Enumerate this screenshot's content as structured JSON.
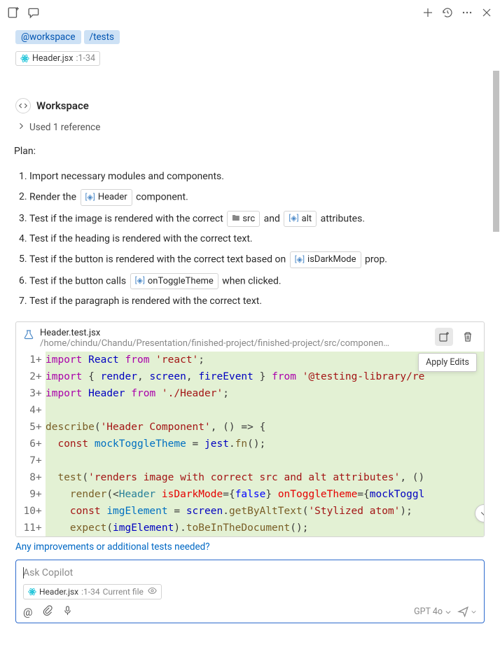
{
  "toolbar": {
    "new_chat_icon": "new-chat",
    "chat_icon": "chat-bubble"
  },
  "badges": {
    "workspace": "@workspace",
    "tests": "/tests"
  },
  "file_ref": {
    "name": "Header.jsx",
    "range": ":1-34"
  },
  "section": {
    "title": "Workspace",
    "references": "Used 1 reference"
  },
  "plan_label": "Plan:",
  "plan": [
    {
      "pre": "Import necessary modules and components.",
      "chips": []
    },
    {
      "pre": "Render the ",
      "chips": [
        {
          "icon": "sym",
          "text": "Header"
        }
      ],
      "post": " component."
    },
    {
      "pre": "Test if the image is rendered with the correct ",
      "chips": [
        {
          "icon": "folder",
          "text": "src"
        }
      ],
      "mid": " and ",
      "chips2": [
        {
          "icon": "sym",
          "text": "alt"
        }
      ],
      "post": " attributes."
    },
    {
      "pre": "Test if the heading is rendered with the correct text.",
      "chips": []
    },
    {
      "pre": "Test if the button is rendered with the correct text based on ",
      "chips": [
        {
          "icon": "sym",
          "text": "isDarkMode"
        }
      ],
      "post": " prop."
    },
    {
      "pre": "Test if the button calls ",
      "chips": [
        {
          "icon": "sym",
          "text": "onToggleTheme"
        }
      ],
      "post": " when clicked."
    },
    {
      "pre": "Test if the paragraph is rendered with the correct text.",
      "chips": []
    }
  ],
  "code_panel": {
    "filename": "Header.test.jsx",
    "filepath": "/home/chindu/Chandu/Presentation/finished-project/finished-project/src/componen…",
    "tooltip": "Apply Edits"
  },
  "code_lines": [
    {
      "n": "1",
      "plus": "+",
      "html": "<span class='tok-import'>import</span> <span class='tok-id'>React</span> <span class='tok-from'>from</span> <span class='tok-str'>'react'</span>;"
    },
    {
      "n": "2",
      "plus": "+",
      "html": "<span class='tok-import'>import</span> { <span class='tok-id'>render</span>, <span class='tok-id'>screen</span>, <span class='tok-id'>fireEvent</span> } <span class='tok-from'>from</span> <span class='tok-str'>'@testing-library/re</span>"
    },
    {
      "n": "3",
      "plus": "+",
      "html": "<span class='tok-import'>import</span> <span class='tok-id'>Header</span> <span class='tok-from'>from</span> <span class='tok-str'>'./Header'</span>;"
    },
    {
      "n": "4",
      "plus": "+",
      "html": ""
    },
    {
      "n": "5",
      "plus": "+",
      "html": "<span class='tok-fn'>describe</span>(<span class='tok-str'>'Header Component'</span>, () <span class='tok-op'>=&gt;</span> {"
    },
    {
      "n": "6",
      "plus": "+",
      "html": "  <span class='tok-kw'>const</span> <span class='tok-param'>mockToggleTheme</span> = <span class='tok-id'>jest</span>.<span class='tok-fn'>fn</span>();"
    },
    {
      "n": "7",
      "plus": "+",
      "html": ""
    },
    {
      "n": "8",
      "plus": "+",
      "html": "  <span class='tok-fn'>test</span>(<span class='tok-str'>'renders image with correct src and alt attributes'</span>, ()"
    },
    {
      "n": "9",
      "plus": "+",
      "html": "    <span class='tok-fn'>render</span>(&lt;<span class='tok-comp'>Header</span> <span class='tok-attr'>isDarkMode</span>={<span class='tok-bool'>false</span>} <span class='tok-attr'>onToggleTheme</span>={<span class='tok-id'>mockToggl</span>"
    },
    {
      "n": "10",
      "plus": "+",
      "html": "    <span class='tok-kw'>const</span> <span class='tok-param'>imgElement</span> = <span class='tok-id'>screen</span>.<span class='tok-fn'>getByAltText</span>(<span class='tok-str'>'Stylized atom'</span>);"
    },
    {
      "n": "11",
      "plus": "+",
      "html": "    <span class='tok-fn'>expect</span>(<span class='tok-id'>imgElement</span>).<span class='tok-fn'>toBeInTheDocument</span>();"
    }
  ],
  "followup": "Any improvements or additional tests needed?",
  "input": {
    "placeholder": "Ask Copilot",
    "context_file": "Header.jsx",
    "context_range": ":1-34",
    "context_label": "Current file",
    "model": "GPT 4o"
  }
}
